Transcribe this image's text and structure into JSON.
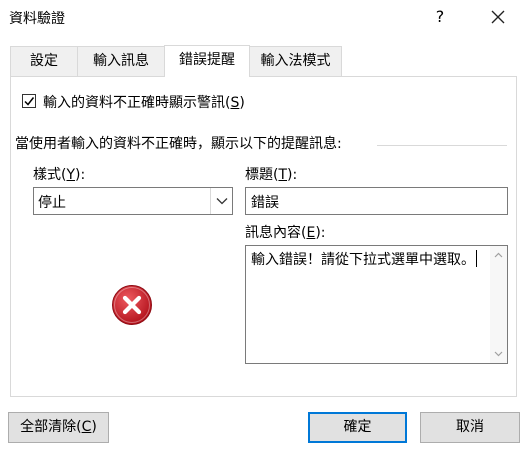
{
  "window": {
    "title": "資料驗證",
    "help_label": "?"
  },
  "tabs": [
    {
      "label": "設定"
    },
    {
      "label": "輸入訊息"
    },
    {
      "label": "錯誤提醒"
    },
    {
      "label": "輸入法模式"
    }
  ],
  "active_tab": "錯誤提醒",
  "show_error": {
    "checked": true,
    "label_prefix": "輸入的資料不正確時顯示警訊(",
    "label_mnemonic": "S",
    "label_suffix": ")"
  },
  "group_label": "當使用者輸入的資料不正確時，顯示以下的提醒訊息:",
  "style_field": {
    "label_prefix": "樣式(",
    "label_mnemonic": "Y",
    "label_suffix": "):",
    "value": "停止"
  },
  "title_field": {
    "label_prefix": "標題(",
    "label_mnemonic": "T",
    "label_suffix": "):",
    "value": "錯誤"
  },
  "message_field": {
    "label_prefix": "訊息內容(",
    "label_mnemonic": "E",
    "label_suffix": "):",
    "value": "輸入錯誤！請從下拉式選單中選取。"
  },
  "icons": {
    "style_icon": "error-stop-icon",
    "accent": "#0078d7",
    "error_red": "#c4202b"
  },
  "buttons": {
    "clear_all_prefix": "全部清除(",
    "clear_all_mnemonic": "C",
    "clear_all_suffix": ")",
    "ok": "確定",
    "cancel": "取消"
  }
}
